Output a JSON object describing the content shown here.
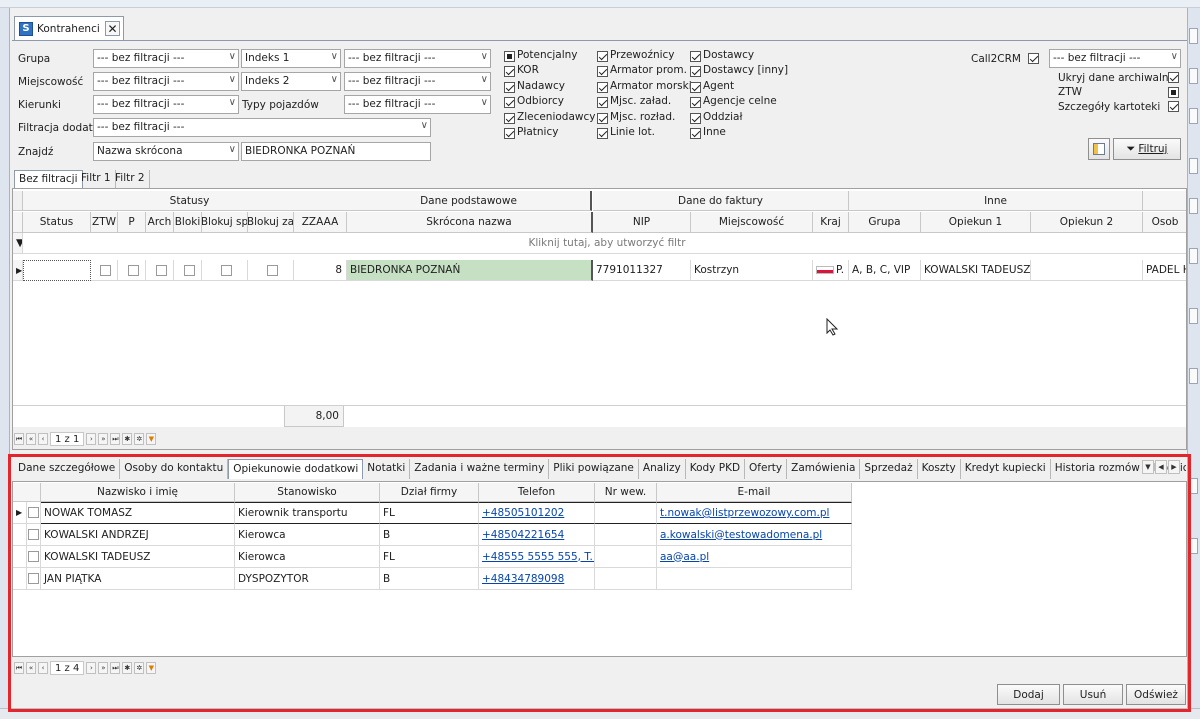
{
  "window": {
    "tab_title": "Kontrahenci"
  },
  "filters": {
    "grupa_label": "Grupa",
    "grupa_value": "--- bez filtracji ---",
    "indeks1_label": "Indeks 1",
    "indeks1_value": "--- bez filtracji ---",
    "miejscowosc_label": "Miejscowość",
    "miejscowosc_value": "--- bez filtracji ---",
    "indeks2_label": "Indeks 2",
    "indeks2_value": "--- bez filtracji ---",
    "kierunki_label": "Kierunki",
    "kierunki_value": "--- bez filtracji ---",
    "typy_label": "Typy pojazdów",
    "typy_value": "--- bez filtracji ---",
    "dodat_label": "Filtracja dodat.",
    "dodat_value": "--- bez filtracji ---",
    "znajdz_label": "Znajdź",
    "znajdz_field": "Nazwa skrócona",
    "znajdz_value": "BIEDRONKA POZNAŃ",
    "call2crm_label": "Call2CRM",
    "call2crm_value": "--- bez filtracji ---",
    "ukryj_label": "Ukryj dane archiwalne",
    "ztw_label": "ZTW",
    "szczegoly_label": "Szczegóły kartoteki",
    "filtruj_label": "Filtruj",
    "checkboxes_col1": [
      "Potencjalny",
      "KOR",
      "Nadawcy",
      "Odbiorcy",
      "Zleceniodawcy",
      "Płatnicy"
    ],
    "checkboxes_col2": [
      "Przewoźnicy",
      "Armator prom.",
      "Armator morski",
      "Mjsc. załad.",
      "Mjsc. rozład.",
      "Linie lot."
    ],
    "checkboxes_col3": [
      "Dostawcy",
      "Dostawcy [inny]",
      "Agent",
      "Agencje celne",
      "Oddział",
      "Inne"
    ]
  },
  "filter_tabs": [
    "Bez filtracji",
    "Filtr 1",
    "Filtr 2"
  ],
  "main_grid": {
    "groups": [
      "Statusy",
      "Dane podstawowe",
      "Dane do faktury",
      "Inne"
    ],
    "columns": [
      "Status",
      "ZTW",
      "P",
      "Arch",
      "Bloki",
      "Blokuj sp",
      "Blokuj za",
      "ZZAAA",
      "Skrócona nazwa",
      "NIP",
      "Miejscowość",
      "Kraj",
      "Grupa",
      "Opiekun 1",
      "Opiekun 2",
      "Osob"
    ],
    "filter_hint": "Kliknij tutaj, aby utworzyć filtr",
    "row": {
      "zzaaa": "8",
      "name": "BIEDRONKA POZNAŃ",
      "nip": "7791011327",
      "city": "Kostrzyn",
      "country": "P.",
      "group": "A, B, C, VIP",
      "opiekun1": "KOWALSKI TADEUSZ",
      "opiekun2": "",
      "osob": "PADEL HI"
    },
    "sum_value": "8,00",
    "pager": "1 z 1"
  },
  "bottom_tabs": [
    "Dane szczegółowe",
    "Osoby do kontaktu",
    "Opiekunowie dodatkowi",
    "Notatki",
    "Zadania i ważne terminy",
    "Pliki powiązane",
    "Analizy",
    "Kody PKD",
    "Oferty",
    "Zamówienia",
    "Sprzedaż",
    "Koszty",
    "Kredyt kupiecki",
    "Historia rozmów telefonicznych",
    "Rozlicz"
  ],
  "detail_grid": {
    "columns": [
      "Nazwisko i imię",
      "Stanowisko",
      "Dział firmy",
      "Telefon",
      "Nr wew.",
      "E-mail"
    ],
    "rows": [
      {
        "name": "NOWAK TOMASZ",
        "role": "Kierownik transportu",
        "dept": "FL",
        "phone": "+48505101202",
        "ext": "",
        "email": "t.nowak@listprzewozowy.com.pl"
      },
      {
        "name": "KOWALSKI ANDRZEJ",
        "role": "Kierowca",
        "dept": "B",
        "phone": "+48504221654",
        "ext": "",
        "email": "a.kowalski@testowadomena.pl"
      },
      {
        "name": "KOWALSKI TADEUSZ",
        "role": "Kierowca",
        "dept": "FL",
        "phone": "+48555 5555 555, T...",
        "ext": "",
        "email": "aa@aa.pl"
      },
      {
        "name": "JAN PIĄTKA",
        "role": "DYSPOZYTOR",
        "dept": "B",
        "phone": "+48434789098",
        "ext": "",
        "email": ""
      }
    ],
    "pager": "1 z 4"
  },
  "actions": {
    "add": "Dodaj",
    "delete": "Usuń",
    "refresh": "Odśwież"
  }
}
